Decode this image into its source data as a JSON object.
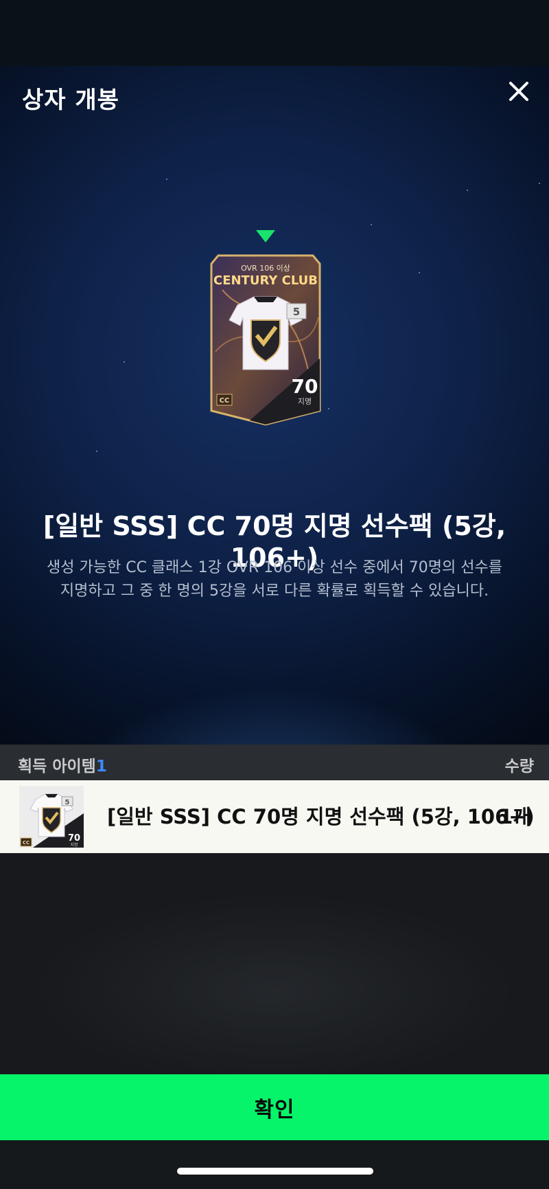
{
  "modal": {
    "title": "상자 개봉",
    "close_icon": "close-icon"
  },
  "card": {
    "subtitle": "OVR 106 이상",
    "brand": "CENTURY CLUB",
    "level": "5",
    "count": "70",
    "count_unit": "지명",
    "badge": "CC"
  },
  "pack": {
    "title": "[일반 SSS] CC 70명 지명 선수팩 (5강, 106+)",
    "description_line1": "생성 가능한 CC 클래스 1강 OVR 106 이상 선수 중에서 70명의 선수를",
    "description_line2": "지명하고 그 중 한 명의 5강을 서로 다른 확률로 획득할 수 있습니다."
  },
  "list": {
    "header_label": "획득 아이템",
    "header_count": "1",
    "qty_label": "수량",
    "items": [
      {
        "name": "[일반 SSS] CC 70명 지명 선수팩 (5강, 106+)",
        "quantity": "1개",
        "thumb_level": "5",
        "thumb_count": "70",
        "thumb_unit": "지명",
        "thumb_badge": "CC"
      }
    ]
  },
  "confirm": {
    "label": "확인"
  },
  "colors": {
    "accent": "#06f46a",
    "pointer": "#19e36b",
    "count_highlight": "#3d8bff"
  }
}
